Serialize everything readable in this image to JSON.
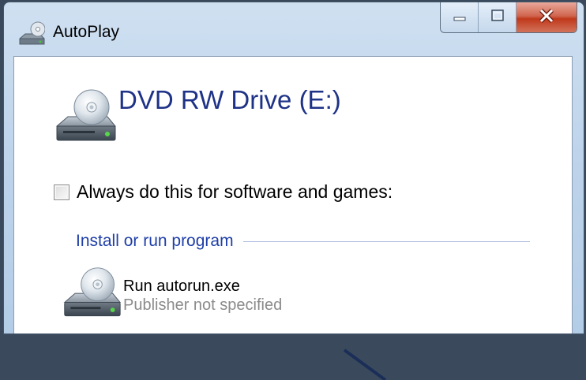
{
  "window": {
    "title": "AutoPlay",
    "icon": "autoplay-icon",
    "caption_buttons": [
      {
        "name": "minimize",
        "icon": "minimize-icon"
      },
      {
        "name": "maximize",
        "icon": "maximize-icon"
      },
      {
        "name": "close",
        "icon": "close-icon",
        "glyph": "X"
      }
    ]
  },
  "drive": {
    "name": "DVD RW Drive (E:)",
    "icon": "dvd-drive-icon"
  },
  "always_checkbox": {
    "label": "Always do this for software and games:",
    "checked": false
  },
  "section": {
    "title": "Install or run program"
  },
  "options": [
    {
      "title": "Run autorun.exe",
      "subtitle": "Publisher not specified",
      "icon": "dvd-drive-icon"
    }
  ],
  "colors": {
    "accent": "#1e3287",
    "section_link": "#1f3fa8",
    "close_red": "#c0391c",
    "frame": "#bcd3ea"
  }
}
